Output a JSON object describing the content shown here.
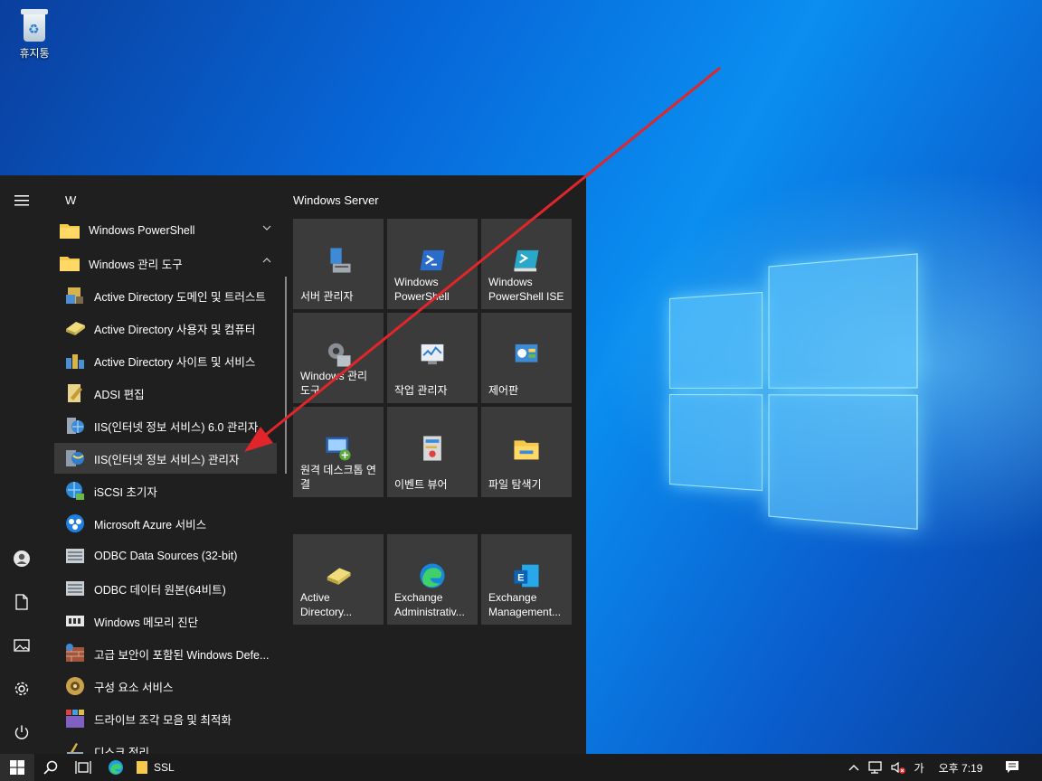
{
  "desktop": {
    "recycle_bin_label": "휴지통",
    "arrow_color": "#e0262a"
  },
  "start_menu": {
    "letter_header": "W",
    "app_list": [
      {
        "label": "Windows PowerShell",
        "icon": "folder-icon",
        "expand": "chevron-down"
      },
      {
        "label": "Windows 관리 도구",
        "icon": "folder-icon",
        "expand": "chevron-up"
      },
      {
        "label": "Active Directory 도메인 및 트러스트",
        "icon": "ad-domains-icon"
      },
      {
        "label": "Active Directory 사용자 및 컴퓨터",
        "icon": "ad-users-icon"
      },
      {
        "label": "Active Directory 사이트 및 서비스",
        "icon": "ad-sites-icon"
      },
      {
        "label": "ADSI 편집",
        "icon": "adsi-edit-icon"
      },
      {
        "label": "IIS(인터넷 정보 서비스) 6.0 관리자",
        "icon": "iis6-manager-icon"
      },
      {
        "label": "IIS(인터넷 정보 서비스) 관리자",
        "icon": "iis-manager-icon",
        "selected": true
      },
      {
        "label": "iSCSI 초기자",
        "icon": "iscsi-icon"
      },
      {
        "label": "Microsoft Azure 서비스",
        "icon": "azure-icon"
      },
      {
        "label": "ODBC Data Sources (32-bit)",
        "icon": "odbc-icon"
      },
      {
        "label": "ODBC 데이터 원본(64비트)",
        "icon": "odbc-icon"
      },
      {
        "label": "Windows 메모리 진단",
        "icon": "memory-diagnostic-icon"
      },
      {
        "label": "고급 보안이 포함된 Windows Defe...",
        "icon": "firewall-icon"
      },
      {
        "label": "구성 요소 서비스",
        "icon": "component-services-icon"
      },
      {
        "label": "드라이브 조각 모음 및 최적화",
        "icon": "defrag-icon"
      },
      {
        "label": "디스크 정리",
        "icon": "disk-cleanup-icon"
      }
    ],
    "tile_group_title": "Windows Server",
    "tiles": [
      {
        "label": "서버 관리자",
        "icon": "server-manager-icon"
      },
      {
        "label": "Windows PowerShell",
        "icon": "powershell-icon"
      },
      {
        "label": "Windows PowerShell ISE",
        "icon": "powershell-ise-icon"
      },
      {
        "label": "Windows 관리 도구",
        "icon": "admin-tools-icon"
      },
      {
        "label": "작업 관리자",
        "icon": "task-manager-icon"
      },
      {
        "label": "제어판",
        "icon": "control-panel-icon"
      },
      {
        "label": "원격 데스크톱 연결",
        "icon": "remote-desktop-icon"
      },
      {
        "label": "이벤트 뷰어",
        "icon": "event-viewer-icon"
      },
      {
        "label": "파일 탐색기",
        "icon": "file-explorer-icon"
      },
      {
        "label": "Active Directory...",
        "icon": "ad-users-icon"
      },
      {
        "label": "Exchange Administrativ...",
        "icon": "edge-icon"
      },
      {
        "label": "Exchange Management...",
        "icon": "exchange-icon"
      }
    ]
  },
  "taskbar": {
    "pinned_label": "SSL",
    "ime_label": "가",
    "clock": "오후 7:19"
  }
}
